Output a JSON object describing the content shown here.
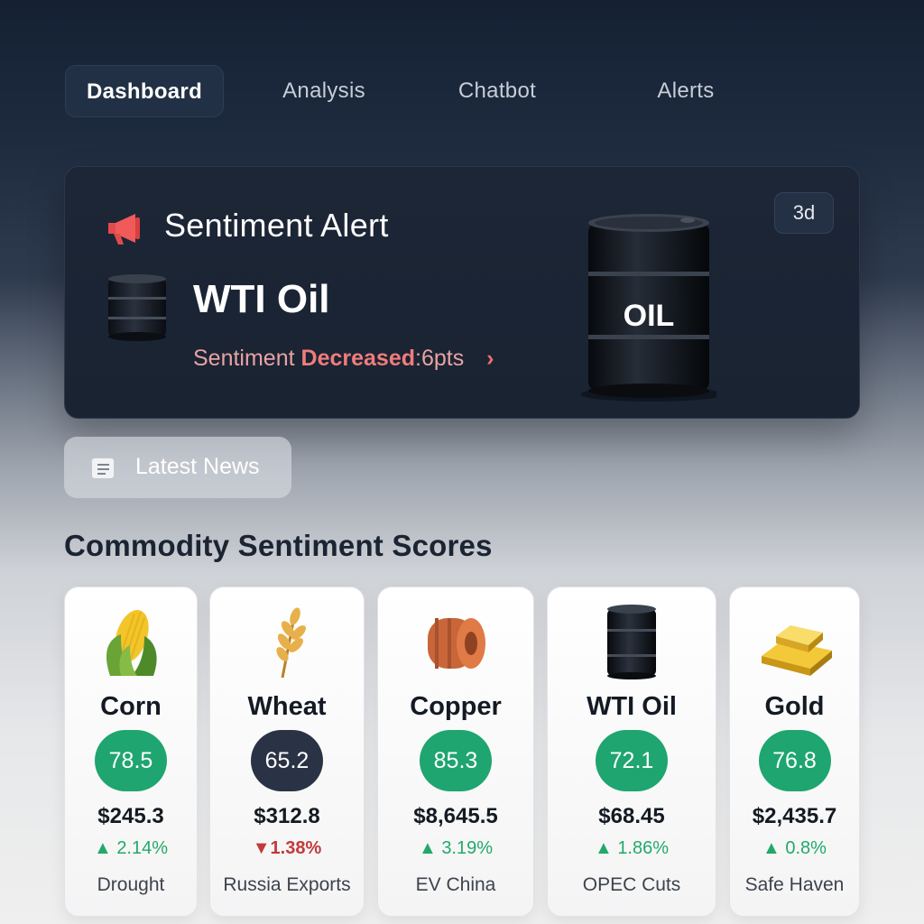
{
  "nav": {
    "tabs": [
      {
        "label": "Dashboard",
        "active": true
      },
      {
        "label": "Analysis",
        "active": false
      },
      {
        "label": "Chatbot",
        "active": false
      },
      {
        "label": "Alerts",
        "active": false
      }
    ]
  },
  "alert": {
    "title": "Sentiment Alert",
    "asset": "WTI Oil",
    "sentiment_prefix": "Sentiment",
    "sentiment_direction": "Decreased",
    "sentiment_amount": ":6pts",
    "chevron": "›",
    "barrel_label": "OIL",
    "age_badge": "3d",
    "icon": "megaphone-icon",
    "accent_color": "#f05a5a"
  },
  "news": {
    "label": "Latest News",
    "icon": "newspaper-icon"
  },
  "section_title": "Commodity Sentiment Scores",
  "commodities": [
    {
      "name": "Corn",
      "icon": "corn-icon",
      "score": "78.5",
      "score_color": "#1fa56f",
      "price": "$245.3",
      "change_symbol": "▲",
      "change": "2.14%",
      "direction": "up",
      "tag": "Drought"
    },
    {
      "name": "Wheat",
      "icon": "wheat-icon",
      "score": "65.2",
      "score_color": "#2a3345",
      "price": "$312.8",
      "change_symbol": "▼",
      "change": "1.38%",
      "direction": "down",
      "tag": "Russia  Exports"
    },
    {
      "name": "Copper",
      "icon": "copper-icon",
      "score": "85.3",
      "score_color": "#1fa56f",
      "price": "$8,645.5",
      "change_symbol": "▲",
      "change": "3.19%",
      "direction": "up",
      "tag": "EV  China"
    },
    {
      "name": "WTI Oil",
      "icon": "oil-barrel-icon",
      "score": "72.1",
      "score_color": "#1fa56f",
      "price": "$68.45",
      "change_symbol": "▲",
      "change": "1.86%",
      "direction": "up",
      "tag": "OPEC  Cuts"
    },
    {
      "name": "Gold",
      "icon": "gold-bar-icon",
      "score": "76.8",
      "score_color": "#1fa56f",
      "price": "$2,435.7",
      "change_symbol": "▲",
      "change": "0.8%",
      "direction": "up",
      "tag": "Safe Haven"
    }
  ]
}
